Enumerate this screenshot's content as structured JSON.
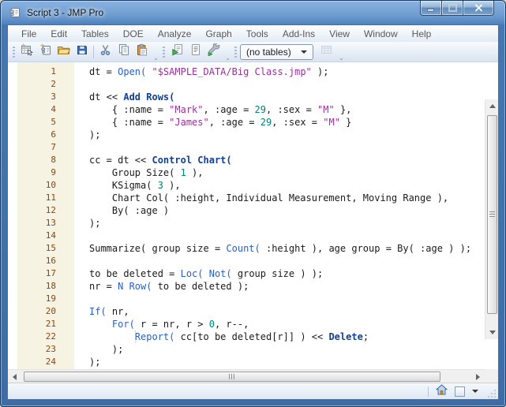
{
  "window": {
    "title": "Script 3 - JMP Pro"
  },
  "menu": {
    "items": [
      "File",
      "Edit",
      "Tables",
      "DOE",
      "Analyze",
      "Graph",
      "Tools",
      "Add-Ins",
      "View",
      "Window",
      "Help"
    ]
  },
  "toolbar": {
    "groups": [
      {
        "name": "file-clipboard",
        "icons": [
          "new-data-table-icon",
          "new-script-icon",
          "open-icon",
          "save-icon",
          "separator",
          "cut-icon",
          "copy-icon",
          "paste-icon"
        ]
      },
      {
        "name": "script",
        "icons": [
          "run-script-icon",
          "log-icon",
          "tools-icon"
        ]
      }
    ],
    "tables_dropdown": {
      "value": "(no tables)"
    },
    "disabled_icon": "data-table-icon"
  },
  "editor": {
    "lines": [
      {
        "num": "1",
        "tokens": [
          [
            "d",
            "dt = "
          ],
          [
            "f",
            "Open("
          ],
          [
            "d",
            " "
          ],
          [
            "s",
            "\"$SAMPLE_DATA/Big Class.jmp\""
          ],
          [
            "d",
            " );"
          ]
        ]
      },
      {
        "num": "2",
        "tokens": []
      },
      {
        "num": "3",
        "tokens": [
          [
            "d",
            "dt << "
          ],
          [
            "m",
            "Add Rows("
          ]
        ]
      },
      {
        "num": "4",
        "tokens": [
          [
            "d",
            "    { :name = "
          ],
          [
            "s",
            "\"Mark\""
          ],
          [
            "d",
            ", :age = "
          ],
          [
            "n",
            "29"
          ],
          [
            "d",
            ", :sex = "
          ],
          [
            "s",
            "\"M\""
          ],
          [
            "d",
            " },"
          ]
        ]
      },
      {
        "num": "5",
        "tokens": [
          [
            "d",
            "    { :name = "
          ],
          [
            "s",
            "\"James\""
          ],
          [
            "d",
            ", :age = "
          ],
          [
            "n",
            "29"
          ],
          [
            "d",
            ", :sex = "
          ],
          [
            "s",
            "\"M\""
          ],
          [
            "d",
            " }"
          ]
        ]
      },
      {
        "num": "6",
        "tokens": [
          [
            "d",
            ");"
          ]
        ]
      },
      {
        "num": "7",
        "tokens": []
      },
      {
        "num": "8",
        "tokens": [
          [
            "d",
            "cc = dt << "
          ],
          [
            "m",
            "Control Chart("
          ]
        ]
      },
      {
        "num": "9",
        "tokens": [
          [
            "d",
            "    Group Size( "
          ],
          [
            "n",
            "1"
          ],
          [
            "d",
            " ),"
          ]
        ]
      },
      {
        "num": "10",
        "tokens": [
          [
            "d",
            "    KSigma( "
          ],
          [
            "n",
            "3"
          ],
          [
            "d",
            " ),"
          ]
        ]
      },
      {
        "num": "11",
        "tokens": [
          [
            "d",
            "    Chart Col( :height, Individual Measurement, Moving Range ),"
          ]
        ]
      },
      {
        "num": "12",
        "tokens": [
          [
            "d",
            "    By( :age )"
          ]
        ]
      },
      {
        "num": "13",
        "tokens": [
          [
            "d",
            ");"
          ]
        ]
      },
      {
        "num": "14",
        "tokens": []
      },
      {
        "num": "15",
        "tokens": [
          [
            "d",
            "Summarize( group size = "
          ],
          [
            "f",
            "Count("
          ],
          [
            "d",
            " :height ), age group = By( :age ) );"
          ]
        ]
      },
      {
        "num": "16",
        "tokens": []
      },
      {
        "num": "17",
        "tokens": [
          [
            "d",
            "to be deleted = "
          ],
          [
            "f",
            "Loc("
          ],
          [
            "d",
            " "
          ],
          [
            "f",
            "Not("
          ],
          [
            "d",
            " group size ) );"
          ]
        ]
      },
      {
        "num": "18",
        "tokens": [
          [
            "d",
            "nr = "
          ],
          [
            "f",
            "N Row("
          ],
          [
            "d",
            " to be deleted );"
          ]
        ]
      },
      {
        "num": "19",
        "tokens": []
      },
      {
        "num": "20",
        "tokens": [
          [
            "f",
            "If("
          ],
          [
            "d",
            " nr,"
          ]
        ]
      },
      {
        "num": "21",
        "tokens": [
          [
            "d",
            "    "
          ],
          [
            "f",
            "For("
          ],
          [
            "d",
            " r = nr, r > "
          ],
          [
            "n",
            "0"
          ],
          [
            "d",
            ", r--,"
          ]
        ]
      },
      {
        "num": "22",
        "guide": 1,
        "tokens": [
          [
            "d",
            "        "
          ],
          [
            "f",
            "Report("
          ],
          [
            "d",
            " cc[to be deleted[r]] ) << "
          ],
          [
            "m",
            "Delete"
          ],
          [
            "d",
            ";"
          ]
        ]
      },
      {
        "num": "23",
        "tokens": [
          [
            "d",
            "    );"
          ]
        ]
      },
      {
        "num": "24",
        "tokens": [
          [
            "d",
            ");"
          ]
        ]
      }
    ]
  },
  "status_bar": {
    "icons": [
      "home-icon",
      "window-square-icon",
      "dropdown-arrow-icon",
      "resize-grip-icon"
    ]
  },
  "colors": {
    "default": "#1a1a1a",
    "function": "#2b5fc4",
    "message": "#123f92",
    "string": "#9b2f9e",
    "number": "#007f80",
    "line_number": "#8b4513",
    "gutter_bg": "#f7f3e2",
    "titlebar_accent": "#4677b1"
  }
}
